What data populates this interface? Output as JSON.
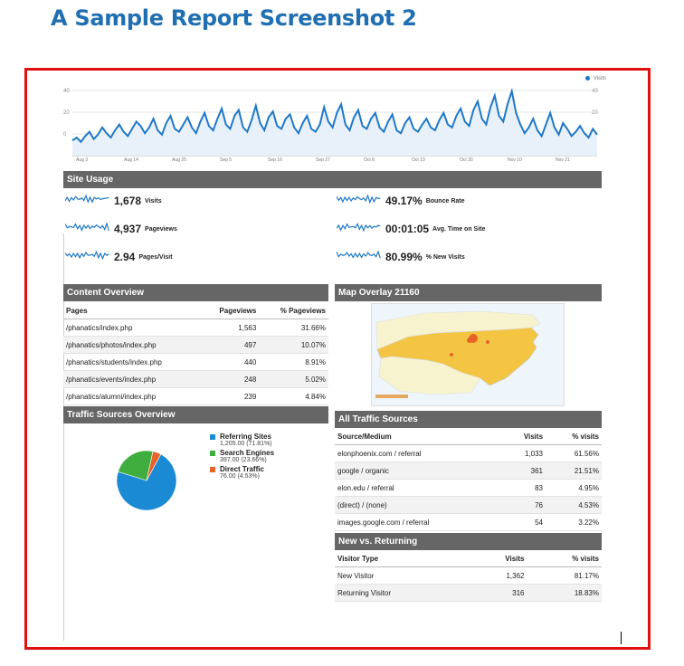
{
  "document": {
    "title": "A Sample Report Screenshot 2"
  },
  "trend": {
    "legend": "Visits",
    "y_ticks": [
      "40",
      "20",
      "0"
    ],
    "y_ticks_right": [
      "40",
      "20"
    ],
    "x_ticks": [
      "Aug 3",
      "Aug 14",
      "Aug 25",
      "Sep 5",
      "Sep 16",
      "Sep 27",
      "Oct 8",
      "Oct 19",
      "Oct 30",
      "Nov 10",
      "Nov 21"
    ]
  },
  "chart_data": {
    "type": "line",
    "title": "",
    "series": [
      {
        "name": "Visits",
        "values": [
          3,
          5,
          2,
          6,
          9,
          4,
          7,
          12,
          8,
          5,
          10,
          14,
          9,
          6,
          11,
          16,
          13,
          8,
          12,
          18,
          10,
          7,
          15,
          20,
          11,
          9,
          14,
          19,
          12,
          8,
          16,
          22,
          13,
          10,
          18,
          25,
          14,
          11,
          20,
          24,
          12,
          9,
          17,
          27,
          15,
          10,
          19,
          23,
          13,
          11,
          18,
          21,
          12,
          8,
          15,
          20,
          11,
          9,
          14,
          26,
          16,
          12,
          22,
          28,
          14,
          10,
          19,
          24,
          13,
          11,
          18,
          22,
          12,
          9,
          16,
          21,
          10,
          8,
          15,
          19,
          11,
          9,
          14,
          18,
          12,
          10,
          17,
          22,
          14,
          12,
          20,
          25,
          16,
          13,
          24,
          30,
          18,
          14,
          26,
          34,
          20,
          16,
          28,
          37,
          22,
          14,
          8,
          12,
          18,
          10,
          6,
          14,
          22,
          12,
          7,
          15,
          11,
          6,
          9,
          13,
          8,
          5,
          11,
          7
        ]
      }
    ],
    "ylim": [
      0,
      40
    ],
    "grid": true,
    "legend_position": "top-right"
  },
  "site_usage": {
    "title": "Site Usage",
    "metrics": [
      {
        "value": "1,678",
        "label": "Visits"
      },
      {
        "value": "49.17%",
        "label": "Bounce Rate"
      },
      {
        "value": "4,937",
        "label": "Pageviews"
      },
      {
        "value": "00:01:05",
        "label": "Avg. Time on Site"
      },
      {
        "value": "2.94",
        "label": "Pages/Visit"
      },
      {
        "value": "80.99%",
        "label": "% New Visits"
      }
    ]
  },
  "content_overview": {
    "title": "Content Overview",
    "headers": [
      "Pages",
      "Pageviews",
      "% Pageviews"
    ],
    "rows": [
      [
        "/phanatics/index.php",
        "1,563",
        "31.66%"
      ],
      [
        "/phanatics/photos/index.php",
        "497",
        "10.07%"
      ],
      [
        "/phanatics/students/index.php",
        "440",
        "8.91%"
      ],
      [
        "/phanatics/events/index.php",
        "248",
        "5.02%"
      ],
      [
        "/phanatics/alumni/index.php",
        "239",
        "4.84%"
      ]
    ]
  },
  "map_overlay": {
    "title": "Map Overlay 21160"
  },
  "traffic_sources": {
    "title": "Traffic Sources Overview",
    "items": [
      {
        "name": "Referring Sites",
        "value": "1,205.00 (71.81%)",
        "color": "#1a8ad4",
        "share": 71.81
      },
      {
        "name": "Search Engines",
        "value": "397.00 (23.66%)",
        "color": "#3fae3f",
        "share": 23.66
      },
      {
        "name": "Direct Traffic",
        "value": "76.00 (4.53%)",
        "color": "#e8632a",
        "share": 4.53
      }
    ]
  },
  "all_traffic": {
    "title": "All Traffic Sources",
    "headers": [
      "Source/Medium",
      "Visits",
      "% visits"
    ],
    "rows": [
      [
        "elonphoenix.com / referral",
        "1,033",
        "61.56%"
      ],
      [
        "google / organic",
        "361",
        "21.51%"
      ],
      [
        "elon.edu / referral",
        "83",
        "4.95%"
      ],
      [
        "(direct) / (none)",
        "76",
        "4.53%"
      ],
      [
        "images.google.com / referral",
        "54",
        "3.22%"
      ]
    ]
  },
  "new_returning": {
    "title": "New vs. Returning",
    "headers": [
      "Visitor Type",
      "Visits",
      "% visits"
    ],
    "rows": [
      [
        "New Visitor",
        "1,362",
        "81.17%"
      ],
      [
        "Returning Visitor",
        "316",
        "18.83%"
      ]
    ]
  }
}
